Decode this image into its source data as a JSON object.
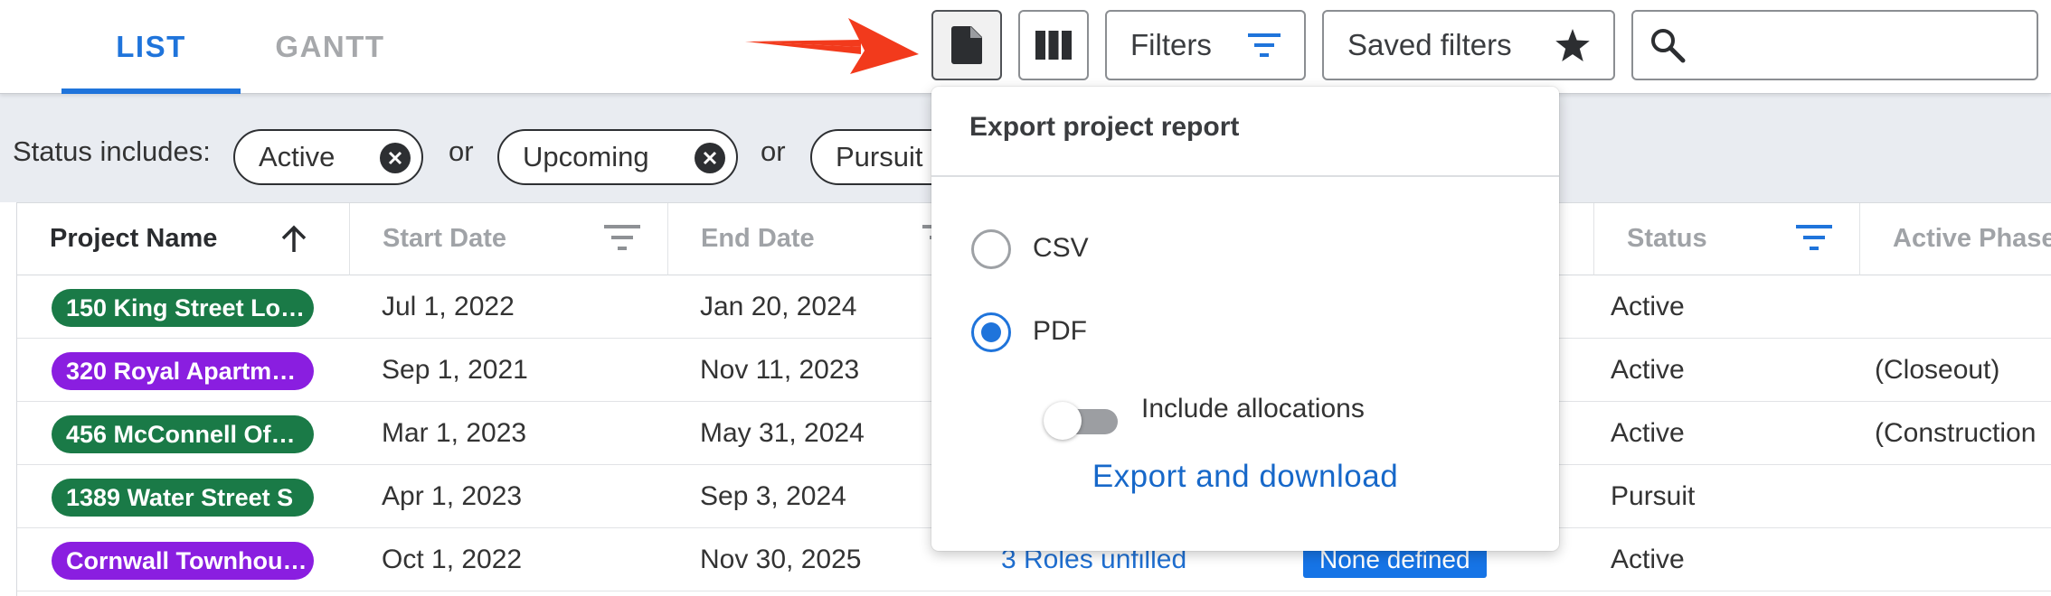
{
  "tabs": [
    {
      "label": "LIST",
      "active": true
    },
    {
      "label": "GANTT",
      "active": false
    }
  ],
  "toolbar": {
    "export_icon": "file-icon",
    "columns_icon": "columns-icon",
    "filters_label": "Filters",
    "saved_filters_label": "Saved filters",
    "search_placeholder": ""
  },
  "status_filter": {
    "label": "Status includes:",
    "connector": "or",
    "chips": [
      "Active",
      "Upcoming",
      "Pursuit"
    ]
  },
  "table": {
    "columns": [
      "Project Name",
      "Start Date",
      "End Date",
      "",
      "",
      "Status",
      "Active Phase"
    ],
    "rows": [
      {
        "name": "150 King Street Lo…",
        "color": "green",
        "start": "Jul 1, 2022",
        "end": "Jan 20, 2024",
        "roles": "",
        "badge": "",
        "status": "Active",
        "phase": ""
      },
      {
        "name": "320 Royal Apartm…",
        "color": "purple",
        "start": "Sep 1, 2021",
        "end": "Nov 11, 2023",
        "roles": "",
        "badge": "",
        "status": "Active",
        "phase": "(Closeout)"
      },
      {
        "name": "456 McConnell Of…",
        "color": "green",
        "start": "Mar 1, 2023",
        "end": "May 31, 2024",
        "roles": "",
        "badge": "",
        "status": "Active",
        "phase": "(Construction"
      },
      {
        "name": "1389 Water Street S",
        "color": "green",
        "start": "Apr 1, 2023",
        "end": "Sep 3, 2024",
        "roles": "",
        "badge": "",
        "status": "Pursuit",
        "phase": ""
      },
      {
        "name": "Cornwall Townhou…",
        "color": "purple",
        "start": "Oct 1, 2022",
        "end": "Nov 30, 2025",
        "roles": "3 Roles unfilled",
        "badge": "None defined",
        "status": "Active",
        "phase": ""
      }
    ]
  },
  "export_menu": {
    "title": "Export project report",
    "options": [
      {
        "label": "CSV",
        "selected": false
      },
      {
        "label": "PDF",
        "selected": true
      }
    ],
    "toggle_label": "Include allocations",
    "toggle_on": false,
    "action_label": "Export and download"
  },
  "colors": {
    "accent": "#1f74db",
    "pill_green": "#1a7a47",
    "pill_purple": "#8a1ee0",
    "arrow": "#f23a1c"
  }
}
